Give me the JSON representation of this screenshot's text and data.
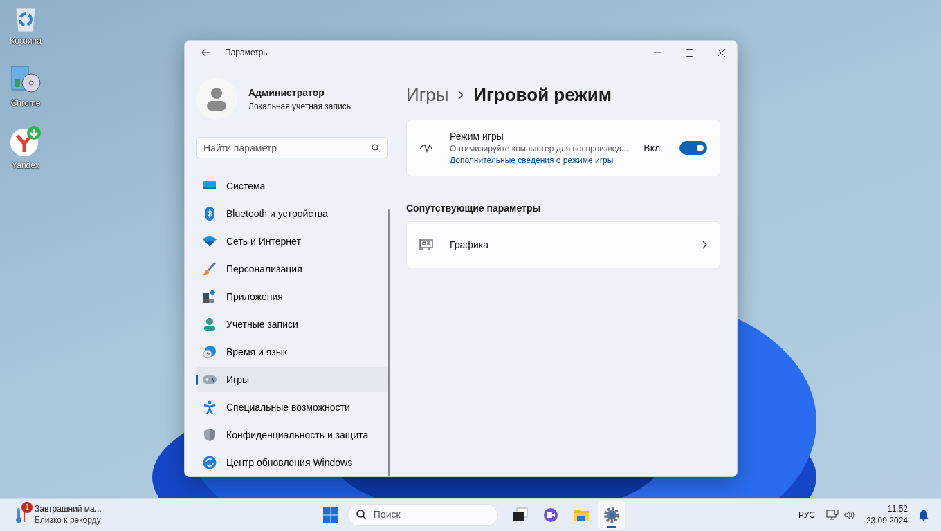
{
  "desktop_icons": [
    {
      "label": "Корзина",
      "kind": "recycle"
    },
    {
      "label": "Chrome",
      "kind": "installer"
    },
    {
      "label": "Yandex",
      "kind": "yandex"
    }
  ],
  "window": {
    "title": "Параметры",
    "account": {
      "name": "Администратор",
      "type": "Локальная учетная запись"
    },
    "search": {
      "placeholder": "Найти параметр"
    },
    "nav": [
      {
        "label": "Система",
        "kind": "system",
        "selected": false
      },
      {
        "label": "Bluetooth и устройства",
        "kind": "bluetooth",
        "selected": false
      },
      {
        "label": "Сеть и Интернет",
        "kind": "wifi",
        "selected": false
      },
      {
        "label": "Персонализация",
        "kind": "brush",
        "selected": false
      },
      {
        "label": "Приложения",
        "kind": "apps",
        "selected": false
      },
      {
        "label": "Учетные записи",
        "kind": "person",
        "selected": false
      },
      {
        "label": "Время и язык",
        "kind": "time",
        "selected": false
      },
      {
        "label": "Игры",
        "kind": "games",
        "selected": true
      },
      {
        "label": "Специальные возможности",
        "kind": "access",
        "selected": false
      },
      {
        "label": "Конфиденциальность и защита",
        "kind": "shield",
        "selected": false
      },
      {
        "label": "Центр обновления Windows",
        "kind": "update",
        "selected": false
      }
    ],
    "breadcrumb": {
      "parent": "Игры",
      "current": "Игровой режим"
    },
    "game_mode": {
      "title": "Режим игры",
      "description": "Оптимизируйте компьютер для воспроизвед...",
      "link": "Дополнительные сведения о режиме игры",
      "state_label": "Вкл.",
      "on": true
    },
    "related": {
      "heading": "Сопутствующие параметры",
      "items": [
        {
          "label": "Графика"
        }
      ]
    }
  },
  "taskbar": {
    "widget": {
      "title": "Завтрашний ма...",
      "subtitle": "Близко к рекорду",
      "badge": "1"
    },
    "search": {
      "placeholder": "Поиск"
    },
    "apps": [
      {
        "kind": "taskview",
        "selected": false
      },
      {
        "kind": "meet",
        "selected": false
      },
      {
        "kind": "folder",
        "selected": false
      },
      {
        "kind": "settings",
        "selected": true
      }
    ],
    "language": "РУС",
    "time": "11:52",
    "date": "23.09.2024"
  }
}
